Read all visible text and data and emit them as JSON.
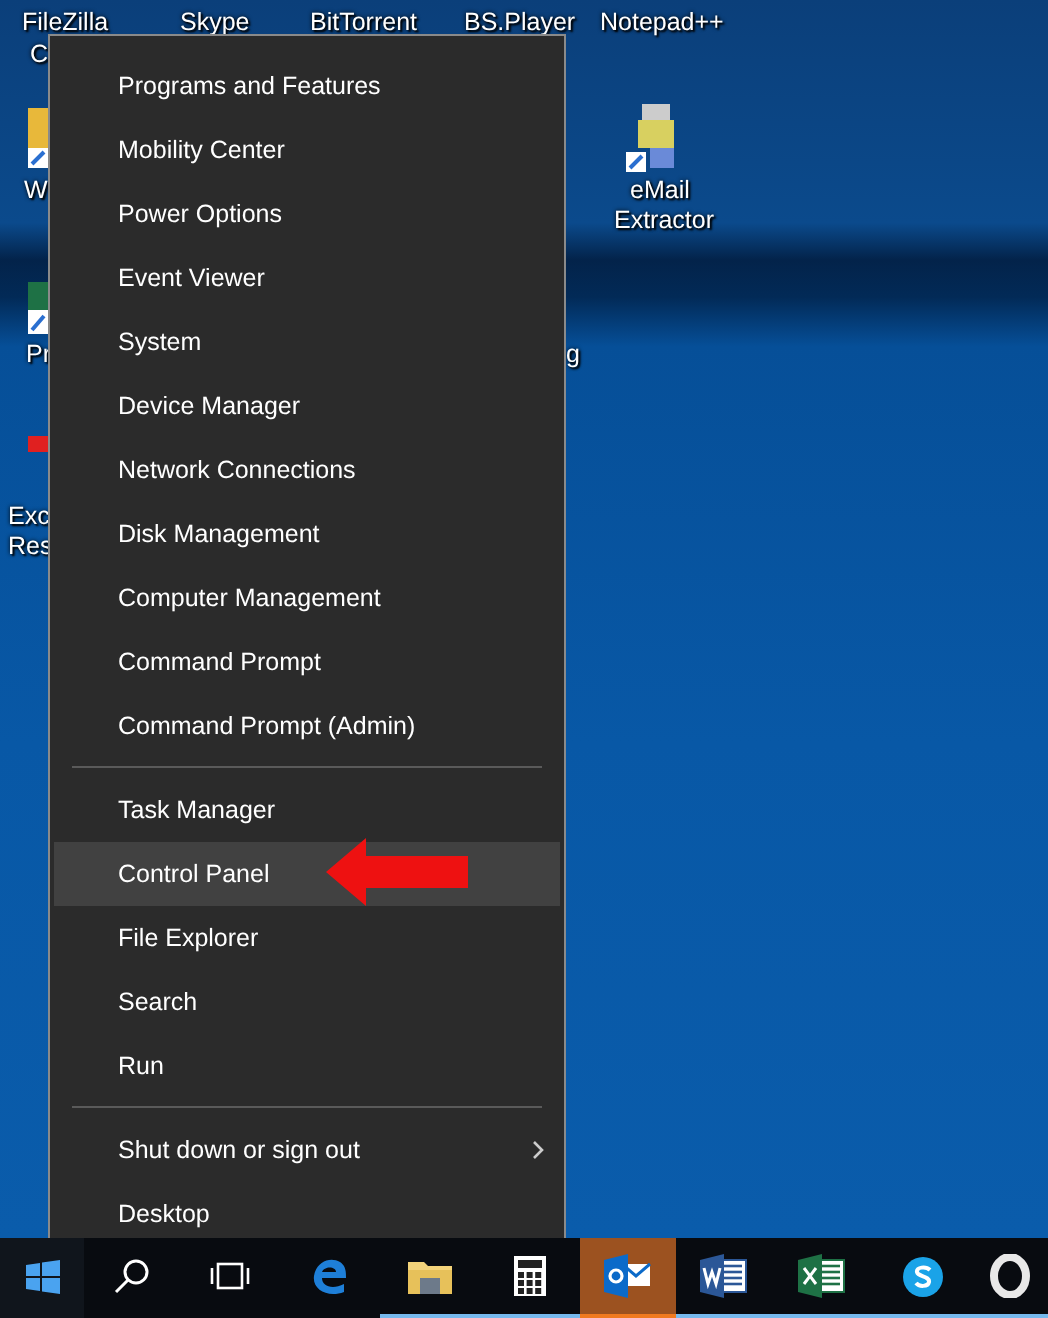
{
  "desktop_labels": [
    {
      "text": "FileZilla"
    },
    {
      "text": "C"
    },
    {
      "text": "Skype"
    },
    {
      "text": "BitTorrent"
    },
    {
      "text": "BS.Player"
    },
    {
      "text": "Notepad++"
    },
    {
      "text": "W"
    },
    {
      "text": "eMail"
    },
    {
      "text": "Extractor"
    },
    {
      "text": "Pr"
    },
    {
      "text": "g"
    },
    {
      "text": "Exc"
    },
    {
      "text": "Res"
    }
  ],
  "menu": {
    "groups": [
      {
        "items": [
          {
            "label": "Programs and Features",
            "selected": false
          },
          {
            "label": "Mobility Center",
            "selected": false
          },
          {
            "label": "Power Options",
            "selected": false
          },
          {
            "label": "Event Viewer",
            "selected": false
          },
          {
            "label": "System",
            "selected": false
          },
          {
            "label": "Device Manager",
            "selected": false
          },
          {
            "label": "Network Connections",
            "selected": false
          },
          {
            "label": "Disk Management",
            "selected": false
          },
          {
            "label": "Computer Management",
            "selected": false
          },
          {
            "label": "Command Prompt",
            "selected": false
          },
          {
            "label": "Command Prompt (Admin)",
            "selected": false
          }
        ]
      },
      {
        "items": [
          {
            "label": "Task Manager",
            "selected": false
          },
          {
            "label": "Control Panel",
            "selected": true
          },
          {
            "label": "File Explorer",
            "selected": false
          },
          {
            "label": "Search",
            "selected": false
          },
          {
            "label": "Run",
            "selected": false
          }
        ]
      },
      {
        "items": [
          {
            "label": "Shut down or sign out",
            "selected": false,
            "submenu": true
          },
          {
            "label": "Desktop",
            "selected": false
          }
        ]
      }
    ]
  },
  "annotation": {
    "kind": "arrow"
  },
  "taskbar": [
    {
      "kind": "start",
      "running": false,
      "selected": false
    },
    {
      "kind": "search",
      "running": false,
      "selected": false
    },
    {
      "kind": "taskview",
      "running": false,
      "selected": false
    },
    {
      "kind": "edge",
      "running": false,
      "selected": false
    },
    {
      "kind": "explorer",
      "running": true,
      "selected": false
    },
    {
      "kind": "calculator",
      "running": true,
      "selected": false
    },
    {
      "kind": "outlook",
      "running": true,
      "selected": true
    },
    {
      "kind": "word",
      "running": true,
      "selected": false
    },
    {
      "kind": "excel",
      "running": true,
      "selected": false
    },
    {
      "kind": "skype",
      "running": true,
      "selected": false
    },
    {
      "kind": "opera",
      "running": true,
      "selected": false
    }
  ]
}
